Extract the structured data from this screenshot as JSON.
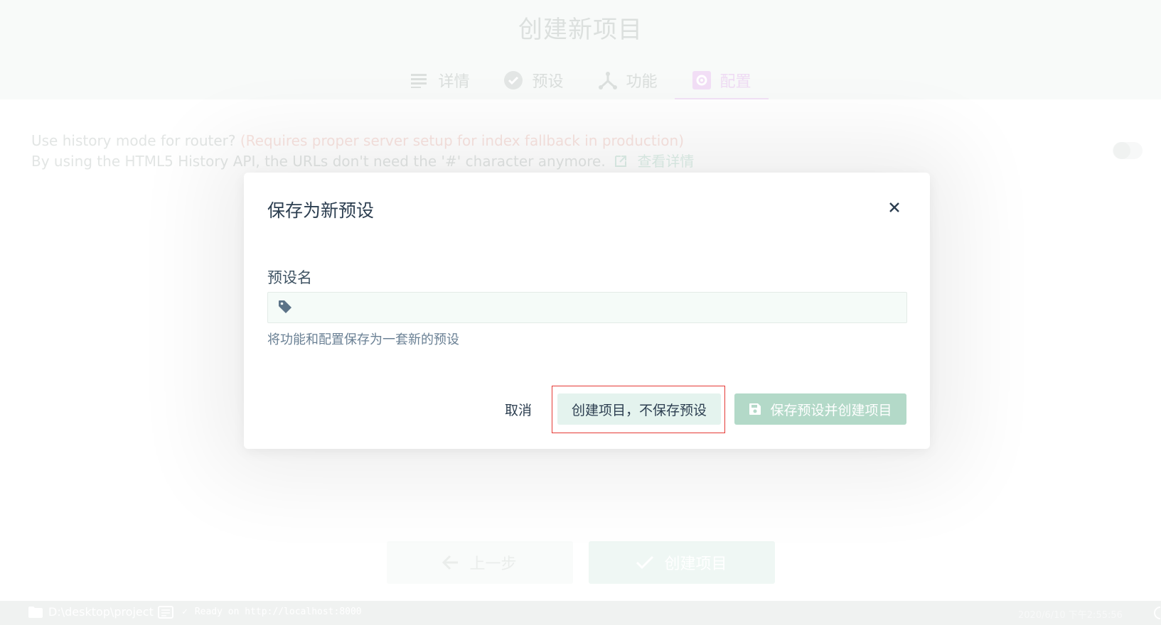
{
  "page": {
    "title": "创建新项目",
    "steps": [
      {
        "label": "详情",
        "icon": "list-icon"
      },
      {
        "label": "预设",
        "icon": "check-circle-icon"
      },
      {
        "label": "功能",
        "icon": "merge-icon"
      },
      {
        "label": "配置",
        "icon": "settings-icon",
        "active": true
      }
    ],
    "option": {
      "question": "Use history mode for router?",
      "warning": "(Requires proper server setup for index fallback in production)",
      "description": "By using the HTML5 History API, the URLs don't need the '#' character anymore.",
      "link_label": "查看详情"
    },
    "buttons": {
      "prev_label": "上一步",
      "create_label": "创建项目"
    }
  },
  "statusbar": {
    "path": "D:\\desktop\\project",
    "ready_text": "Ready on http://localhost:8000",
    "datetime": "2020/6/10 下午2:55:56"
  },
  "modal": {
    "title": "保存为新预设",
    "field_label": "预设名",
    "input_value": "",
    "input_placeholder": "",
    "hint": "将功能和配置保存为一套新的预设",
    "cancel_label": "取消",
    "nosave_label": "创建项目，不保存预设",
    "save_label": "保存预设并创建项目"
  },
  "colors": {
    "primary": "#42b983",
    "text": "#2c3e50",
    "highlight": "#e53935"
  }
}
